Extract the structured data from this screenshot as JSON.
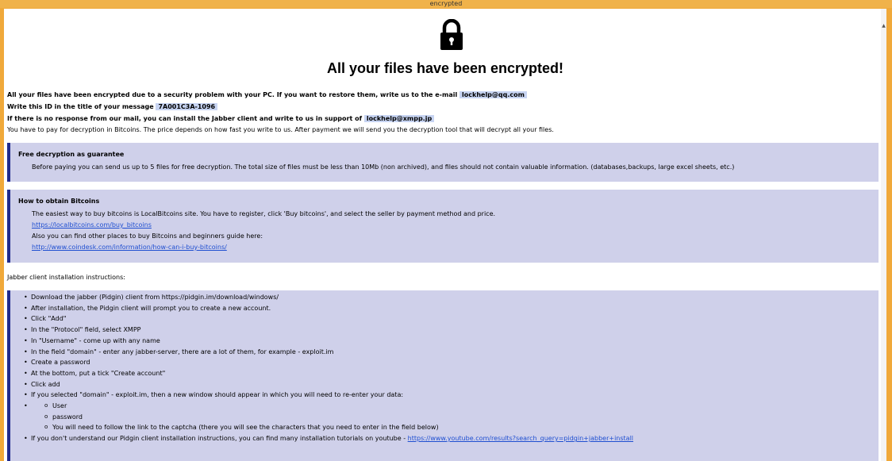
{
  "window": {
    "title": "encrypted"
  },
  "colors": {
    "titlebar": "#f0b24a",
    "box_bg": "#cfd0ea",
    "box_border": "#1f2a8c",
    "highlight": "#c7d4f2",
    "link": "#1f4fd1"
  },
  "header": {
    "icon": "lock-icon",
    "headline": "All your files have been encrypted!"
  },
  "intro": {
    "line1_text": "All your files have been encrypted due to a security problem with your PC. If you want to restore them, write us to the e-mail",
    "email": "lockhelp@qq.com",
    "line2_text": "Write this ID in the title of your message",
    "id": "7A001C3A-1096",
    "line3_text": "If there is no response from our mail, you can install the Jabber client and write to us in support of",
    "jabber": "lockhelp@xmpp.jp",
    "line4_text": "You have to pay for decryption in Bitcoins. The price depends on how fast you write to us. After payment we will send you the decryption tool that will decrypt all your files."
  },
  "guarantee": {
    "title": "Free decryption as guarantee",
    "text": "Before paying you can send us up to 5 files for free decryption. The total size of files must be less than 10Mb (non archived), and files should not contain valuable information. (databases,backups, large excel sheets, etc.)"
  },
  "bitcoins": {
    "title": "How to obtain Bitcoins",
    "text1": "The easiest way to buy bitcoins is LocalBitcoins site. You have to register, click 'Buy bitcoins', and select the seller by payment method and price.",
    "link1": "https://localbitcoins.com/buy_bitcoins",
    "text2": "Also you can find other places to buy Bitcoins and beginners guide here:",
    "link2": "http://www.coindesk.com/information/how-can-i-buy-bitcoins/"
  },
  "jabber_heading": "Jabber client installation instructions:",
  "steps": {
    "s0": "Download the jabber (Pidgin) client from https://pidgin.im/download/windows/",
    "s1": "After installation, the Pidgin client will prompt you to create a new account.",
    "s2": "Click \"Add\"",
    "s3": "In the \"Protocol\" field, select XMPP",
    "s4": "In \"Username\" - come up with any name",
    "s5": "In the field \"domain\" - enter any jabber-server, there are a lot of them, for example - exploit.im",
    "s6": "Create a password",
    "s7": "At the bottom, put a tick \"Create account\"",
    "s8": "Click add",
    "s9": "If you selected \"domain\" - exploit.im, then a new window should appear in which you will need to re-enter your data:",
    "sub0": "User",
    "sub1": "password",
    "sub2": "You will need to follow the link to the captcha (there you will see the characters that you need to enter in the field below)",
    "s10_text": "If you don't understand our Pidgin client installation instructions, you can find many installation tutorials on youtube -",
    "s10_link": "https://www.youtube.com/results?search_query=pidgin+jabber+install"
  }
}
